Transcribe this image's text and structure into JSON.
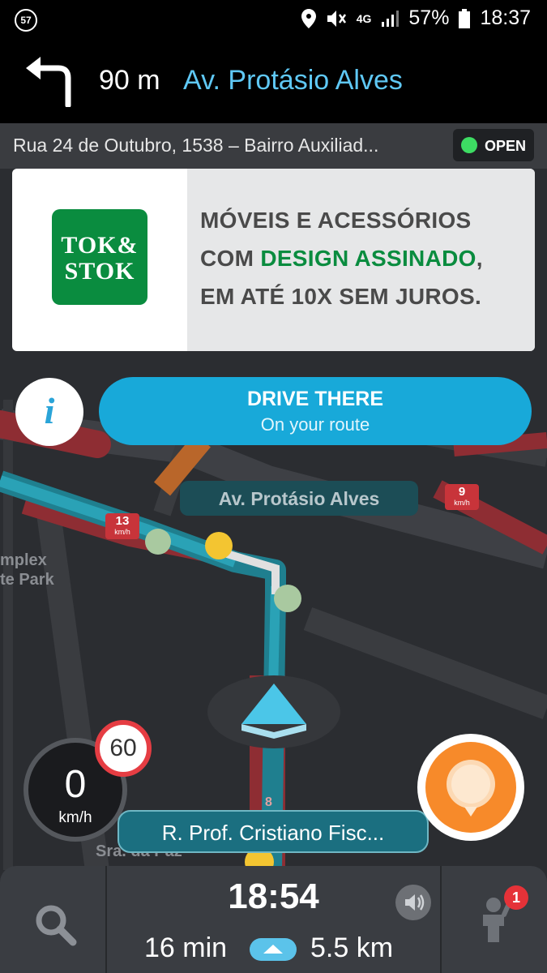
{
  "status_bar": {
    "notification_count": "57",
    "network": "4G",
    "battery": "57%",
    "time": "18:37",
    "icons": [
      "location-icon",
      "mute-icon",
      "signal-icon",
      "battery-icon"
    ]
  },
  "navigation": {
    "turn_icon": "turn-left-icon",
    "distance": "90 m",
    "street": "Av. Protásio Alves"
  },
  "destination": {
    "address": "Rua 24 de Outubro, 1538 – Bairro Auxiliad...",
    "status": "OPEN",
    "status_color": "#3ddc63"
  },
  "ad": {
    "logo_line1": "TOK&",
    "logo_line2": "STOK",
    "line1": "MÓVEIS E ACESSÓRIOS",
    "line2_prefix": "COM ",
    "line2_highlight": "DESIGN ASSINADO",
    "line2_suffix": ",",
    "line3": "EM ATÉ 10X SEM JUROS.",
    "brand_color": "#0a8c3f"
  },
  "actions": {
    "info_symbol": "i",
    "drive_title": "DRIVE THERE",
    "drive_subtitle": "On your route"
  },
  "map": {
    "street_label": "Av. Protásio Alves",
    "poi_line1": "mplex",
    "poi_line2": "te Park",
    "bottom_poi": "Sra. da Paz",
    "speed_markers": [
      {
        "value": "13",
        "unit": "km/h"
      },
      {
        "value": "9",
        "unit": "km/h"
      }
    ],
    "road_number": "8"
  },
  "speed": {
    "value": "0",
    "unit": "km/h",
    "limit": "60"
  },
  "current_street": "R. Prof. Cristiano Fisc...",
  "bottom_bar": {
    "eta": "18:54",
    "duration": "16 min",
    "distance": "5.5 km",
    "notifications": "1"
  }
}
